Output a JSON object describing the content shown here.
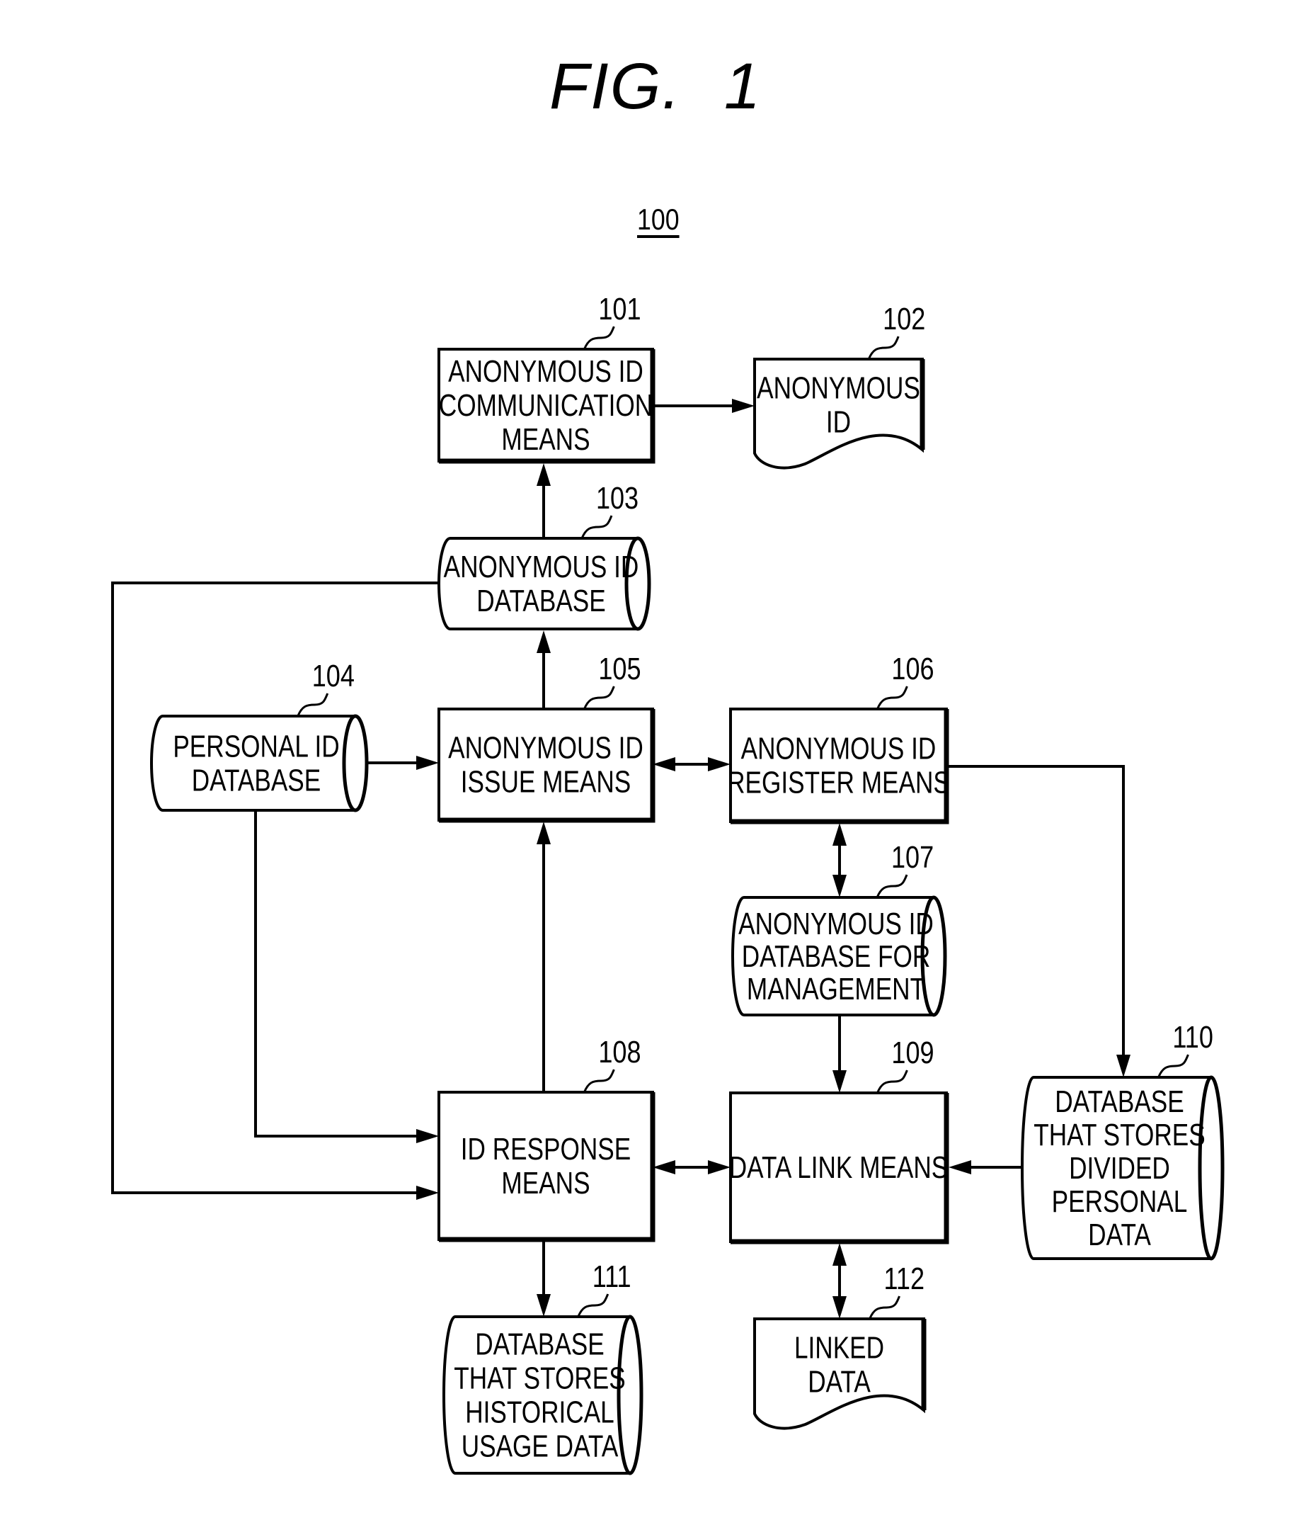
{
  "figure": {
    "title_prefix": "FIG.",
    "title_number": "1",
    "system_label": "100"
  },
  "nodes": {
    "n101": {
      "ref": "101",
      "shape": "process",
      "lines": [
        "ANONYMOUS ID",
        "COMMUNICATION",
        "MEANS"
      ]
    },
    "n102": {
      "ref": "102",
      "shape": "document",
      "lines": [
        "ANONYMOUS",
        "ID"
      ]
    },
    "n103": {
      "ref": "103",
      "shape": "database",
      "lines": [
        "ANONYMOUS ID",
        "DATABASE"
      ]
    },
    "n104": {
      "ref": "104",
      "shape": "database",
      "lines": [
        "PERSONAL ID",
        "DATABASE"
      ]
    },
    "n105": {
      "ref": "105",
      "shape": "process",
      "lines": [
        "ANONYMOUS ID",
        "ISSUE MEANS"
      ]
    },
    "n106": {
      "ref": "106",
      "shape": "process",
      "lines": [
        "ANONYMOUS ID",
        "REGISTER MEANS"
      ]
    },
    "n107": {
      "ref": "107",
      "shape": "database",
      "lines": [
        "ANONYMOUS ID",
        "DATABASE FOR",
        "MANAGEMENT"
      ]
    },
    "n108": {
      "ref": "108",
      "shape": "process",
      "lines": [
        "ID RESPONSE",
        "MEANS"
      ]
    },
    "n109": {
      "ref": "109",
      "shape": "process",
      "lines": [
        "DATA LINK MEANS"
      ]
    },
    "n110": {
      "ref": "110",
      "shape": "database",
      "lines": [
        "DATABASE",
        "THAT STORES",
        "DIVIDED",
        "PERSONAL",
        "DATA"
      ]
    },
    "n111": {
      "ref": "111",
      "shape": "database",
      "lines": [
        "DATABASE",
        "THAT STORES",
        "HISTORICAL",
        "USAGE DATA"
      ]
    },
    "n112": {
      "ref": "112",
      "shape": "document",
      "lines": [
        "LINKED",
        "DATA"
      ]
    }
  },
  "edges": [
    {
      "from": "101",
      "to": "102",
      "direction": "forward"
    },
    {
      "from": "103",
      "to": "101",
      "direction": "forward"
    },
    {
      "from": "105",
      "to": "103",
      "direction": "forward"
    },
    {
      "from": "104",
      "to": "105",
      "direction": "forward"
    },
    {
      "from": "105",
      "to": "106",
      "direction": "both"
    },
    {
      "from": "106",
      "to": "107",
      "direction": "both"
    },
    {
      "from": "106",
      "to": "110",
      "direction": "forward"
    },
    {
      "from": "107",
      "to": "109",
      "direction": "forward"
    },
    {
      "from": "108",
      "to": "105",
      "direction": "forward"
    },
    {
      "from": "104",
      "to": "108",
      "direction": "forward"
    },
    {
      "from": "103",
      "to": "108",
      "direction": "forward"
    },
    {
      "from": "108",
      "to": "109",
      "direction": "both"
    },
    {
      "from": "110",
      "to": "109",
      "direction": "forward"
    },
    {
      "from": "108",
      "to": "111",
      "direction": "forward"
    },
    {
      "from": "109",
      "to": "112",
      "direction": "both"
    }
  ]
}
